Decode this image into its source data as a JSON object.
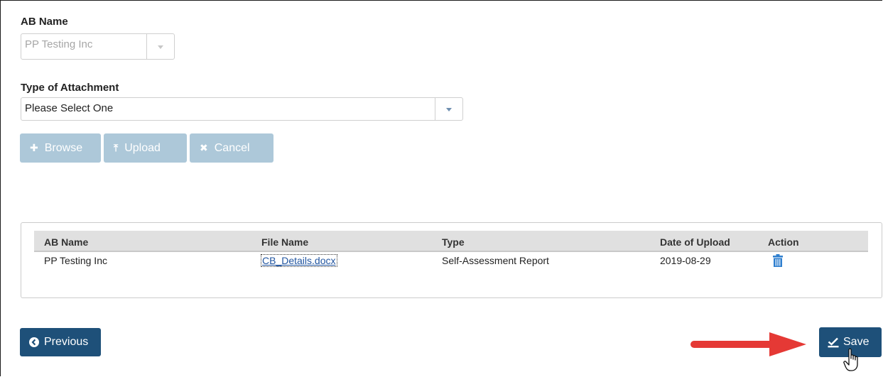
{
  "ab_name": {
    "label": "AB Name",
    "value": "PP Testing Inc"
  },
  "attachment_type": {
    "label": "Type of Attachment",
    "value": "Please Select One"
  },
  "upload_buttons": {
    "browse": "Browse",
    "upload": "Upload",
    "cancel": "Cancel"
  },
  "table": {
    "headers": [
      "AB Name",
      "File Name",
      "Type",
      "Date of Upload",
      "Action"
    ],
    "rows": [
      {
        "ab_name": "PP Testing Inc",
        "file_name": "CB_Details.docx",
        "type": "Self-Assessment Report",
        "date": "2019-08-29",
        "action_icon": "trash-icon"
      }
    ]
  },
  "footer": {
    "previous": "Previous",
    "save": "Save"
  },
  "colors": {
    "primary": "#1e5079",
    "disabled_button": "#adc8d9",
    "annotation_arrow": "#e53935",
    "link": "#2155a0"
  }
}
